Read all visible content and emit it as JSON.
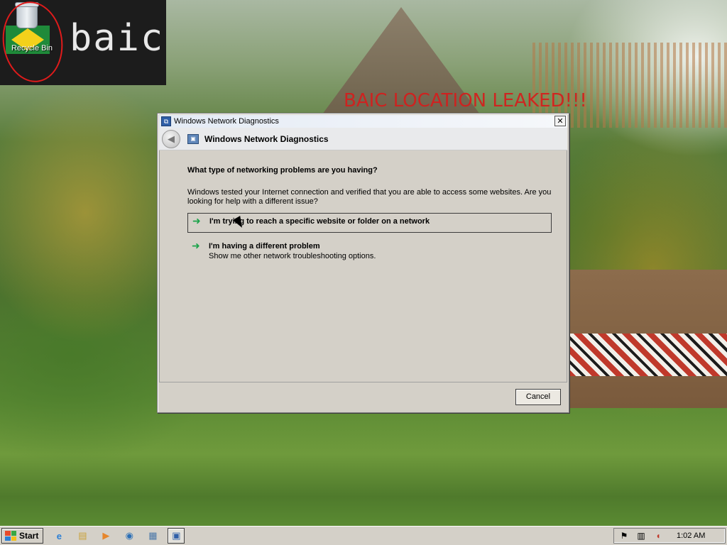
{
  "desktop": {
    "banner_text": "baic",
    "overlay_text": "BAIC LOCATION LEAKED!!!",
    "recycle_bin_label": "Recycle Bin"
  },
  "dialog": {
    "window_title": "Windows Network Diagnostics",
    "header_title": "Windows Network Diagnostics",
    "question": "What type of networking problems are you having?",
    "explanation": "Windows tested your Internet connection and verified that you are able to access some websites. Are you looking for help with a different issue?",
    "options": [
      {
        "main": "I'm trying to reach a specific website or folder on a network",
        "sub": ""
      },
      {
        "main": "I'm having a different problem",
        "sub": "Show me other network troubleshooting options."
      }
    ],
    "cancel_label": "Cancel",
    "close_glyph": "✕"
  },
  "taskbar": {
    "start_label": "Start",
    "quick_launch": [
      "internet-explorer-icon",
      "windows-explorer-icon",
      "media-player-icon",
      "network-icon",
      "server-manager-icon",
      "network-diagnostics-icon"
    ],
    "clock": "1:02 AM"
  },
  "colors": {
    "arrow_green": "#1ba34a",
    "titlebar": "#e4ebf5",
    "dialog_bg": "#d4d0c8",
    "alert_red": "#d81b1b"
  }
}
